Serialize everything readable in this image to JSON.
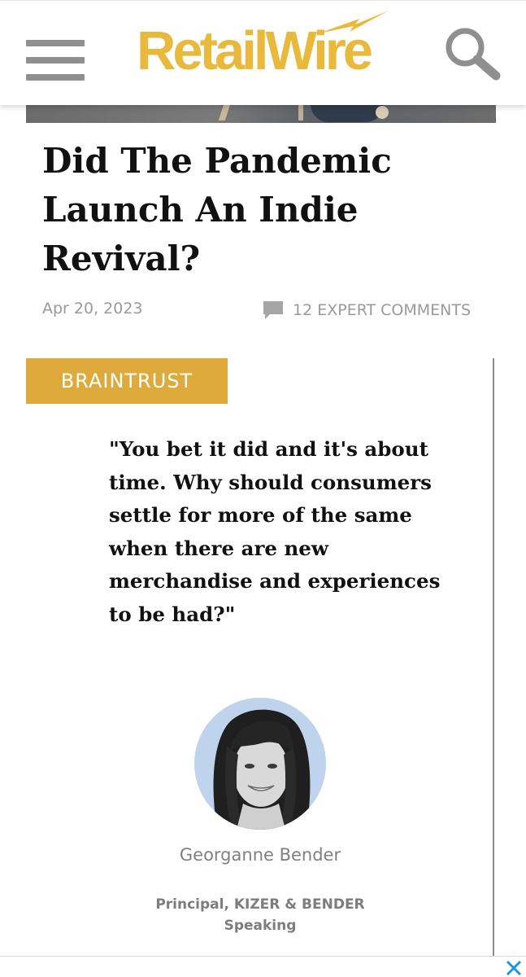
{
  "header": {
    "logo_text": "RetailWire",
    "menu_icon": "hamburger-menu-icon",
    "search_icon": "search-icon",
    "brand_color": "#e8b93a"
  },
  "article": {
    "title": "Did The Pandemic Launch An Indie Revival?",
    "date": "Apr 20, 2023",
    "comments_label": "12 EXPERT COMMENTS",
    "comments_icon": "comment-bubble-icon"
  },
  "braintrust": {
    "badge_label": "BRAINTRUST",
    "badge_color": "#ddaa3b",
    "quote": "\"You bet it did and it's about time. Why should consumers settle for more of the same when there are new merchandise and experiences to be had?\"",
    "author_name": "Georganne Bender",
    "author_title_line1": "Principal, KIZER & BENDER",
    "author_title_line2": "Speaking"
  },
  "ad_bar": {
    "close_icon": "close-icon",
    "close_color": "#1a9bd7"
  }
}
